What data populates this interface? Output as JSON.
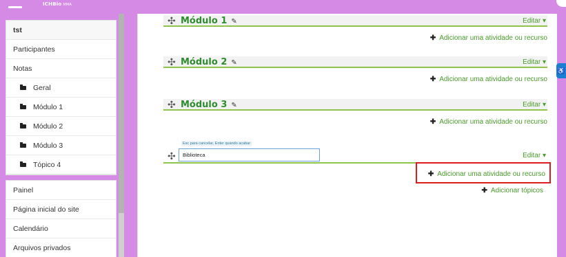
{
  "header": {
    "logo_text": "ICHBio",
    "logo_sub": "MMA"
  },
  "sidebar": {
    "course_items": [
      {
        "label": "tst",
        "type": "course"
      },
      {
        "label": "Participantes",
        "type": "link"
      },
      {
        "label": "Notas",
        "type": "link"
      },
      {
        "label": "Geral",
        "type": "folder"
      },
      {
        "label": "Módulo 1",
        "type": "folder"
      },
      {
        "label": "Módulo 2",
        "type": "folder"
      },
      {
        "label": "Módulo 3",
        "type": "folder"
      },
      {
        "label": "Tópico 4",
        "type": "folder"
      }
    ],
    "site_items": [
      {
        "label": "Painel"
      },
      {
        "label": "Página inicial do site"
      },
      {
        "label": "Calendário"
      },
      {
        "label": "Arquivos privados"
      }
    ]
  },
  "main": {
    "sections": [
      {
        "title": "Módulo 1",
        "edit_label": "Editar ▾",
        "add_label": "Adicionar uma atividade ou recurso"
      },
      {
        "title": "Módulo 2",
        "edit_label": "Editar ▾",
        "add_label": "Adicionar uma atividade ou recurso"
      },
      {
        "title": "Módulo 3",
        "edit_label": "Editar ▾",
        "add_label": "Adicionar uma atividade ou recurso"
      }
    ],
    "editing_section": {
      "hint": "Esc para cancelar, Enter quando acabar",
      "input_value": "Biblioteca",
      "edit_label": "Editar ▾",
      "add_label": "Adicionar uma atividade ou recurso"
    },
    "add_topics_label": "Adicionar tópicos"
  },
  "icons": {
    "move": "move-icon",
    "pencil": "pencil-icon",
    "plus": "plus-icon",
    "folder": "folder-icon"
  },
  "colors": {
    "background": "#d58be6",
    "accent_green": "#4a9b2a",
    "title_green": "#2f8b2f",
    "highlight_red": "#e11b1b"
  }
}
